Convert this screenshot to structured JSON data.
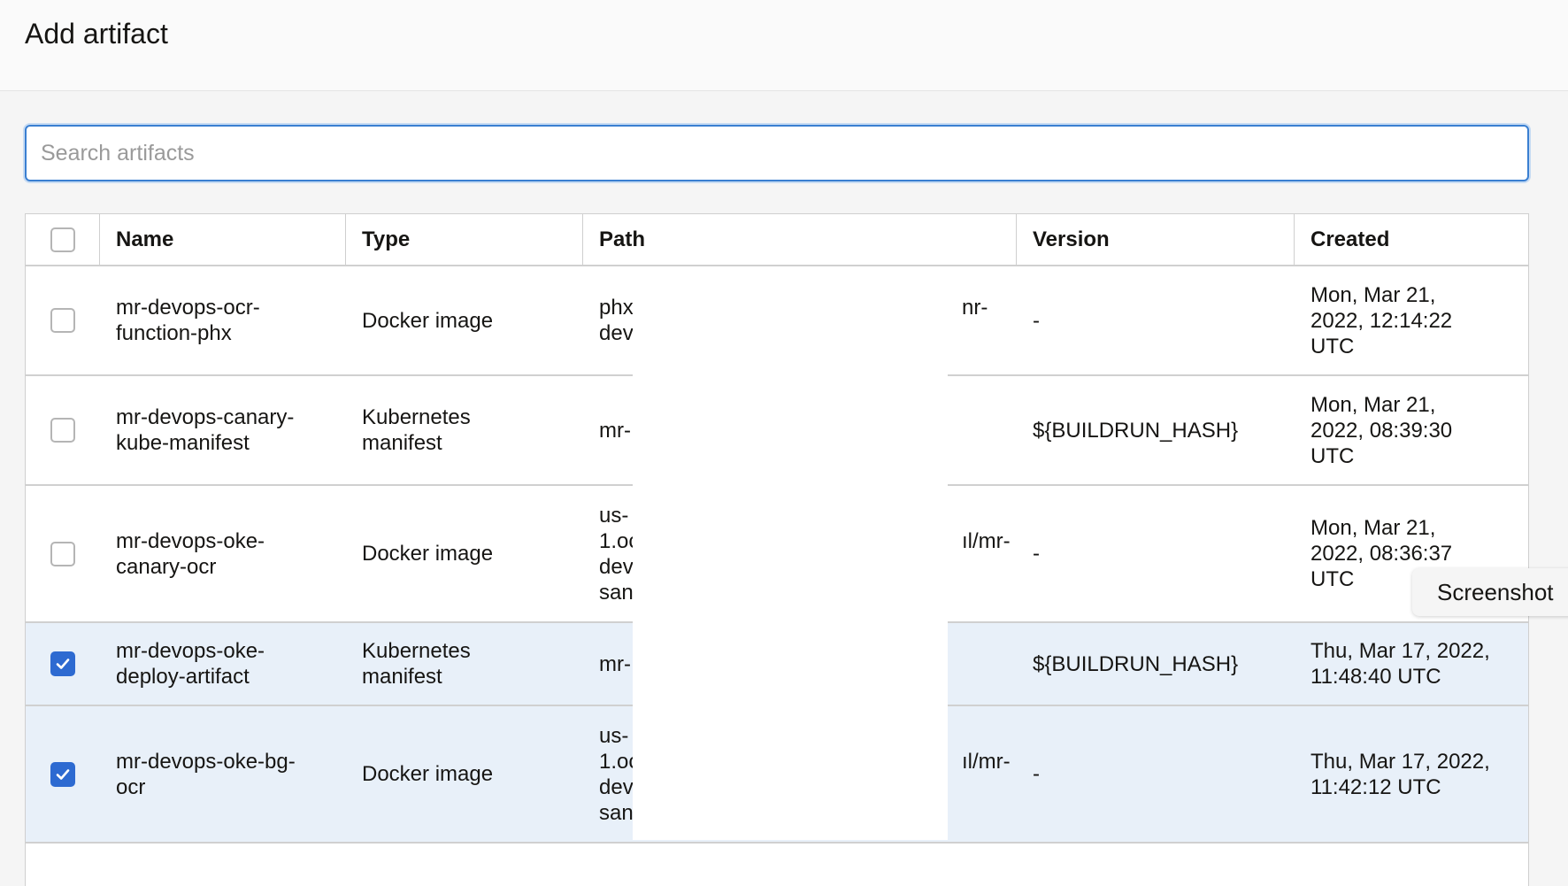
{
  "page": {
    "title": "Add artifact"
  },
  "search": {
    "placeholder": "Search artifacts",
    "value": ""
  },
  "table": {
    "columns": [
      "Name",
      "Type",
      "Path",
      "Version",
      "Created"
    ],
    "rows": [
      {
        "checked": false,
        "name": [
          "mr-devops-ocr-",
          "function-phx"
        ],
        "type": [
          "Docker image"
        ],
        "path": [
          [
            "phx",
            "nr-"
          ],
          [
            "dev",
            ""
          ]
        ],
        "version": "-",
        "created": [
          "Mon, Mar 21,",
          "2022, 12:14:22",
          "UTC"
        ]
      },
      {
        "checked": false,
        "name": [
          "mr-devops-canary-",
          "kube-manifest"
        ],
        "type": [
          "Kubernetes",
          "manifest"
        ],
        "path": [
          [
            "mr-",
            ""
          ]
        ],
        "version": "${BUILDRUN_HASH}",
        "created": [
          "Mon, Mar 21,",
          "2022, 08:39:30",
          "UTC"
        ]
      },
      {
        "checked": false,
        "name": [
          "mr-devops-oke-",
          "canary-ocr"
        ],
        "type": [
          "Docker image"
        ],
        "path": [
          [
            "us-",
            ""
          ],
          [
            "1.oc",
            "ıl/mr-"
          ],
          [
            "dev",
            ""
          ],
          [
            "san",
            ""
          ]
        ],
        "version": "-",
        "created": [
          "Mon, Mar 21,",
          "2022, 08:36:37",
          "UTC"
        ]
      },
      {
        "checked": true,
        "name": [
          "mr-devops-oke-",
          "deploy-artifact"
        ],
        "type": [
          "Kubernetes",
          "manifest"
        ],
        "path": [
          [
            "mr-",
            ""
          ]
        ],
        "version": "${BUILDRUN_HASH}",
        "created": [
          "Thu, Mar 17, 2022,",
          "11:48:40 UTC"
        ]
      },
      {
        "checked": true,
        "name": [
          "mr-devops-oke-bg-",
          "ocr"
        ],
        "type": [
          "Docker image"
        ],
        "path": [
          [
            "us-",
            ""
          ],
          [
            "1.oc",
            "ıl/mr-"
          ],
          [
            "dev",
            ""
          ],
          [
            "san",
            ""
          ]
        ],
        "version": "-",
        "created": [
          "Thu, Mar 17, 2022,",
          "11:42:12 UTC"
        ]
      }
    ]
  },
  "tooltip": {
    "text": "Screenshot"
  },
  "colors": {
    "accent": "#2d6ad1",
    "focus": "#3a7fd1",
    "selected_row": "#e8f0f9"
  },
  "icons": {
    "check": "check-icon"
  }
}
